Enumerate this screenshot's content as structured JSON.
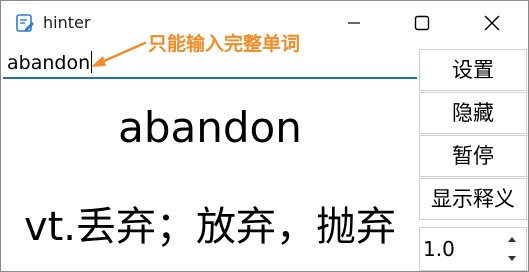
{
  "window": {
    "title": "hinter"
  },
  "annotation": {
    "text": "只能输入完整单词",
    "color": "#f28c28"
  },
  "input": {
    "value": "abandon"
  },
  "display": {
    "word": "abandon",
    "meaning": "vt.丢弃；放弃，抛弃"
  },
  "side_panel": {
    "settings_label": "设置",
    "hide_label": "隐藏",
    "pause_label": "暂停",
    "show_meaning_label": "显示释义",
    "speed_value": "1.0"
  },
  "colors": {
    "accent": "#1f6fb5"
  },
  "icons": {
    "app": "notepad-icon",
    "minimize": "minimize-icon",
    "maximize": "maximize-icon",
    "close": "close-icon",
    "spin_up": "chevron-up-icon",
    "spin_down": "chevron-down-icon"
  }
}
